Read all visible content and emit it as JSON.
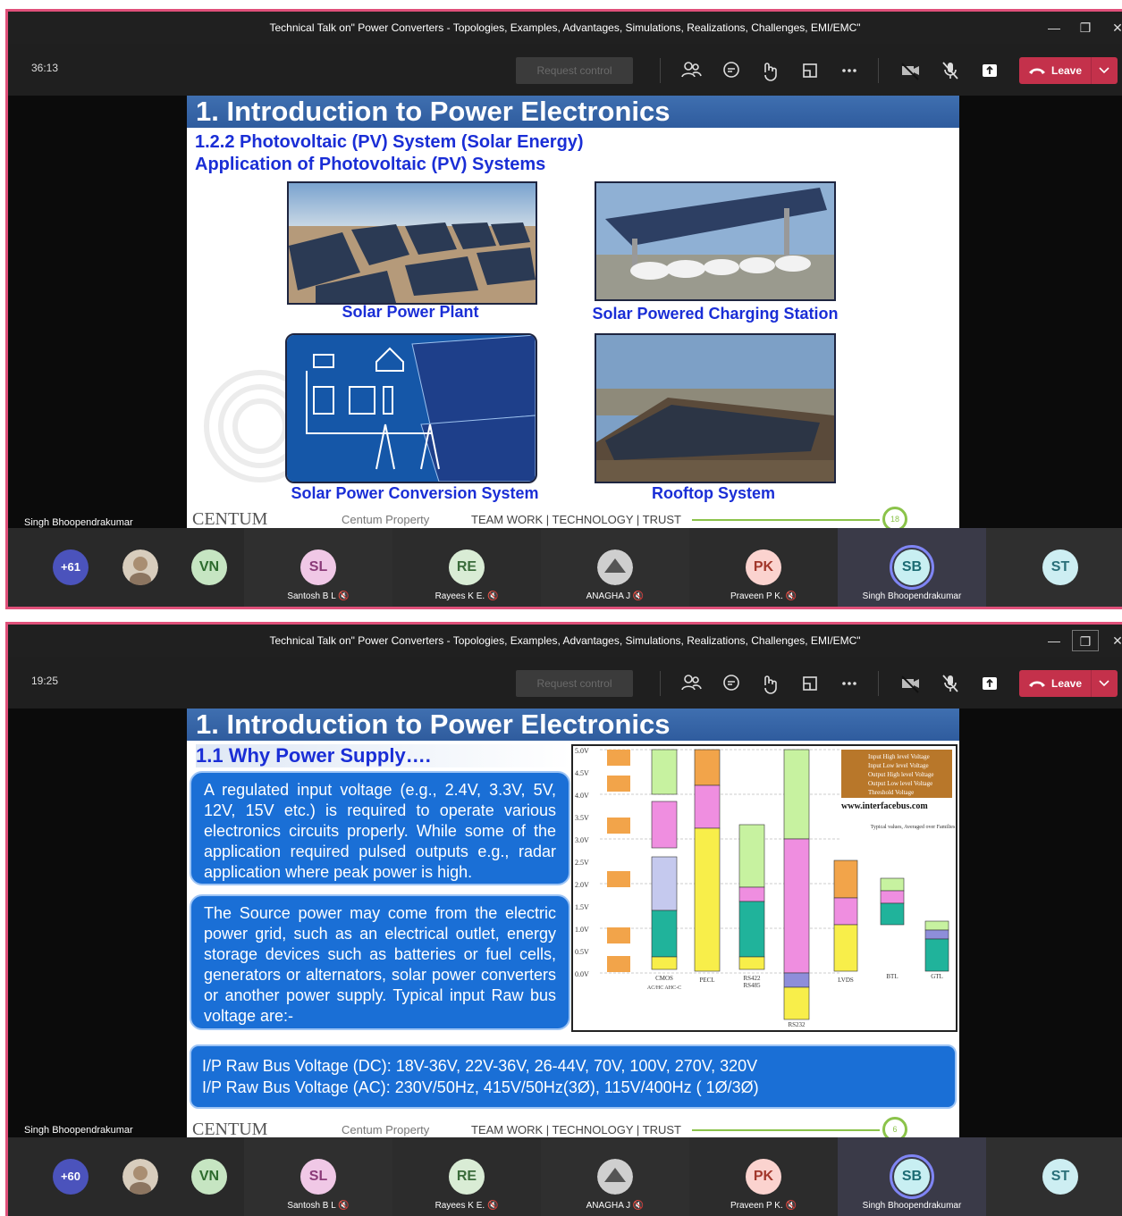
{
  "window1": {
    "title": "Technical Talk on\" Power Converters - Topologies, Examples, Advantages, Simulations, Realizations, Challenges, EMI/EMC\"",
    "timer": "36:13",
    "request_control": "Request control",
    "leave": "Leave",
    "presenter": "Singh Bhoopendrakumar",
    "slide": {
      "title": "1. Introduction to Power Electronics",
      "subtitle1": "1.2.2 Photovoltaic (PV)  System (Solar Energy)",
      "subtitle2": "Application of Photovoltaic (PV) Systems",
      "captions": [
        "Solar Power Plant",
        "Solar Powered Charging Station",
        "Solar Power Conversion System",
        "Rooftop System"
      ],
      "footer_logo": "CENTUM",
      "footer_property": "Centum Property",
      "footer_motto": "TEAM WORK | TECHNOLOGY | TRUST",
      "page": "18"
    },
    "participants": [
      {
        "initials": "+61",
        "name": ""
      },
      {
        "initials": "",
        "name": ""
      },
      {
        "initials": "VN",
        "name": ""
      },
      {
        "initials": "SL",
        "name": "Santosh B L"
      },
      {
        "initials": "RE",
        "name": "Rayees K E."
      },
      {
        "initials": "",
        "name": "ANAGHA J"
      },
      {
        "initials": "PK",
        "name": "Praveen P K."
      },
      {
        "initials": "SB",
        "name": "Singh Bhoopendrakumar"
      },
      {
        "initials": "ST",
        "name": ""
      }
    ]
  },
  "window2": {
    "title": "Technical Talk on\" Power Converters - Topologies, Examples, Advantages, Simulations, Realizations, Challenges, EMI/EMC\"",
    "timer": "19:25",
    "request_control": "Request control",
    "leave": "Leave",
    "presenter": "Singh Bhoopendrakumar",
    "slide": {
      "title": "1. Introduction to Power Electronics",
      "subtitle": "1.1 Why Power Supply….",
      "para1": "A regulated input voltage (e.g., 2.4V, 3.3V, 5V, 12V, 15V etc.) is required to operate various electronics circuits properly. While some of the application required pulsed outputs e.g., radar application where peak power is high.",
      "para2": "The Source power may come from the electric power grid, such as an electrical outlet, energy storage devices such as batteries or fuel cells, generators or alternators, solar power converters or another power supply. Typical input Raw bus voltage are:-",
      "bus_dc": "I/P Raw Bus Voltage (DC): 18V-36V, 22V-36V, 26-44V, 70V, 100V, 270V, 320V",
      "bus_ac": "I/P Raw Bus Voltage (AC): 230V/50Hz, 415V/50Hz(3Ø), 115V/400Hz ( 1Ø/3Ø)",
      "footer_logo": "CENTUM",
      "footer_property": "Centum Property",
      "footer_motto": "TEAM WORK | TECHNOLOGY | TRUST",
      "page": "6",
      "chart": {
        "website": "www.interfacebus.com",
        "legend": [
          "Input High level Voltage",
          "Input Low level Voltage",
          "Output High level Voltage",
          "Output Low level Voltage",
          "Threshold Voltage"
        ],
        "note": "Typical values, Averaged over Families",
        "families": [
          "CMOS",
          "PECL",
          "RS422",
          "RS485",
          "LVDS",
          "BTL",
          "GTL",
          "RS232"
        ],
        "cmos_sub": "AC/HC AHC-C",
        "yticks": [
          "5.0V",
          "4.5V",
          "4.0V",
          "3.5V",
          "3.0V",
          "2.5V",
          "2.0V",
          "1.5V",
          "1.0V",
          "0.5V",
          "0.0V"
        ]
      }
    },
    "participants": [
      {
        "initials": "+60",
        "name": ""
      },
      {
        "initials": "",
        "name": ""
      },
      {
        "initials": "VN",
        "name": ""
      },
      {
        "initials": "SL",
        "name": "Santosh B L"
      },
      {
        "initials": "RE",
        "name": "Rayees K E."
      },
      {
        "initials": "",
        "name": "ANAGHA J"
      },
      {
        "initials": "PK",
        "name": "Praveen P K."
      },
      {
        "initials": "SB",
        "name": "Singh Bhoopendrakumar"
      },
      {
        "initials": "ST",
        "name": ""
      }
    ]
  }
}
